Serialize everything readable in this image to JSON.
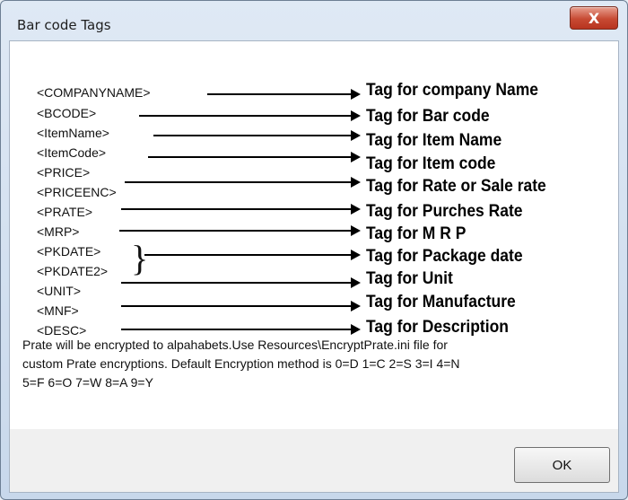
{
  "window": {
    "title": "Bar code Tags",
    "close_label": "X"
  },
  "tags": [
    {
      "tag": "<COMPANYNAME>",
      "description": "Tag for company Name"
    },
    {
      "tag": "<BCODE>",
      "description": "Tag for Bar code"
    },
    {
      "tag": "<ItemName>",
      "description": "Tag for Item Name"
    },
    {
      "tag": "<ItemCode>",
      "description": "Tag for Item code"
    },
    {
      "tag": "<PRICE>",
      "description": ""
    },
    {
      "tag": "<PRICEENC>",
      "description": "Tag for Rate or Sale rate"
    },
    {
      "tag": "<PRATE>",
      "description": "Tag for Purches Rate"
    },
    {
      "tag": "<MRP>",
      "description": "Tag for M R P"
    },
    {
      "tag": "<PKDATE>",
      "description": "Tag for Package date"
    },
    {
      "tag": "<PKDATE2>",
      "description": ""
    },
    {
      "tag": "<UNIT>",
      "description": "Tag for Unit"
    },
    {
      "tag": "<MNF>",
      "description": "Tag for Manufacture"
    },
    {
      "tag": "<DESC>",
      "description": "Tag for Description"
    }
  ],
  "note": {
    "line1": "Prate will be encrypted to alpahabets.Use Resources\\EncryptPrate.ini file for",
    "line2": "custom Prate encryptions. Default Encryption method is 0=D 1=C 2=S 3=I 4=N",
    "line3": "5=F 6=O 7=W 8=A 9=Y"
  },
  "ok_label": "OK"
}
